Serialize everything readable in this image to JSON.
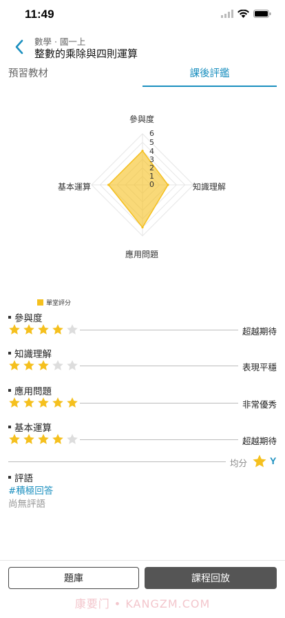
{
  "status_bar": {
    "time": "11:49"
  },
  "nav": {
    "subtitle": "數學 · 國一上",
    "title": "整數的乘除與四則運算"
  },
  "tabs": [
    {
      "label": "預習教材",
      "active": false
    },
    {
      "label": "課後評鑑",
      "active": true
    }
  ],
  "chart_data": {
    "type": "radar",
    "axes": [
      "參與度",
      "知識理解",
      "應用問題",
      "基本運算"
    ],
    "ticks": [
      "0",
      "1",
      "2",
      "3",
      "4",
      "5",
      "6"
    ],
    "range": [
      0,
      6
    ],
    "series": [
      {
        "name": "單堂評分",
        "values": [
          4,
          3,
          5,
          4
        ],
        "color": "#f5c01e"
      }
    ],
    "legend_position": "bottom-left"
  },
  "ratings": [
    {
      "label": "參與度",
      "stars": 4,
      "max": 5,
      "level": "超越期待"
    },
    {
      "label": "知識理解",
      "stars": 3,
      "max": 5,
      "level": "表現平穩"
    },
    {
      "label": "應用問題",
      "stars": 5,
      "max": 5,
      "level": "非常優秀"
    },
    {
      "label": "基本運算",
      "stars": 4,
      "max": 5,
      "level": "超越期待"
    }
  ],
  "average": {
    "label": "均分",
    "grade": "Y"
  },
  "comment": {
    "title": "評語",
    "tag": "#積極回答",
    "empty_text": "尚無評語"
  },
  "buttons": {
    "question_bank": "題庫",
    "course_replay": "課程回放"
  },
  "watermark": "康要门 • KANGZM.COM",
  "colors": {
    "accent": "#1a8fbf",
    "star_filled": "#f5c01e",
    "star_empty": "#dddddd"
  }
}
